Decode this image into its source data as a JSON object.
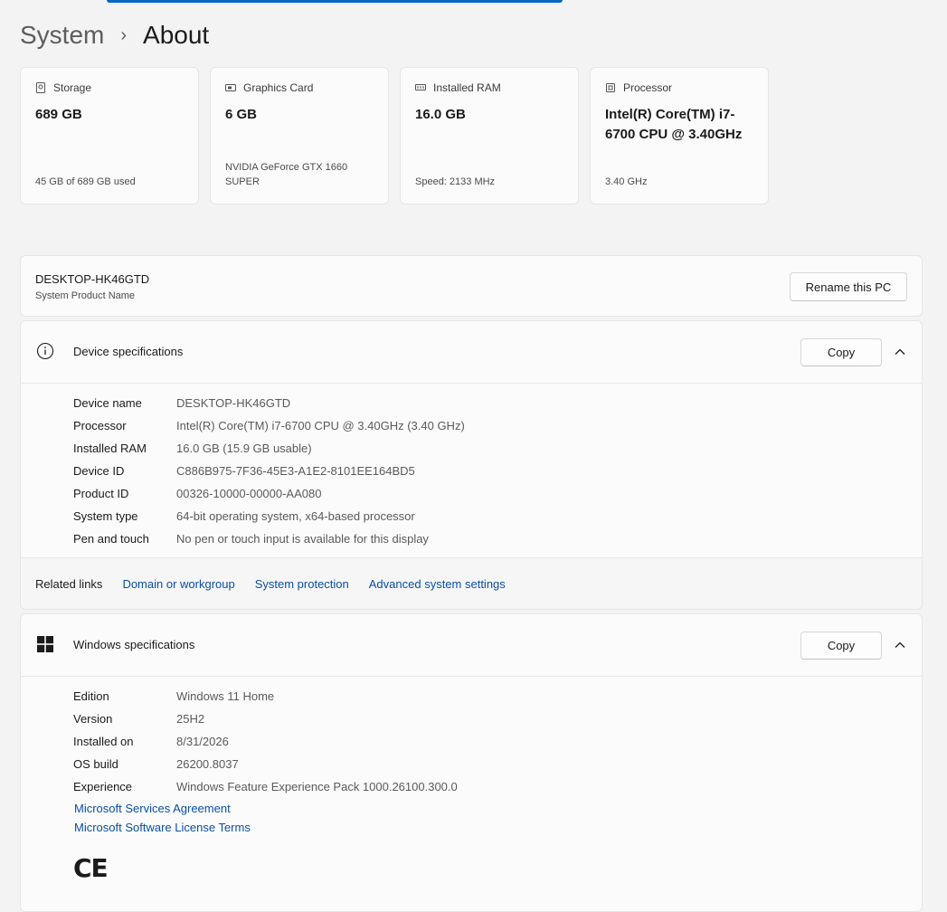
{
  "breadcrumb": {
    "parent": "System",
    "separator": "›",
    "current": "About"
  },
  "cards": [
    {
      "label": "Storage",
      "value": "689 GB",
      "sub": "45 GB of 689 GB used",
      "icon": "storage-icon"
    },
    {
      "label": "Graphics Card",
      "value": "6 GB",
      "sub": "NVIDIA GeForce GTX 1660 SUPER",
      "icon": "graphics-card-icon"
    },
    {
      "label": "Installed RAM",
      "value": "16.0 GB",
      "sub": "Speed: 2133 MHz",
      "icon": "ram-icon"
    },
    {
      "label": "Processor",
      "value": "Intel(R) Core(TM) i7-6700 CPU @ 3.40GHz",
      "sub": "3.40 GHz",
      "icon": "processor-icon"
    }
  ],
  "pc": {
    "name": "DESKTOP-HK46GTD",
    "sub": "System Product Name",
    "rename_label": "Rename this PC"
  },
  "device_specs": {
    "title": "Device specifications",
    "copy_label": "Copy",
    "rows": [
      {
        "label": "Device name",
        "value": "DESKTOP-HK46GTD"
      },
      {
        "label": "Processor",
        "value": "Intel(R) Core(TM) i7-6700 CPU @ 3.40GHz (3.40 GHz)"
      },
      {
        "label": "Installed RAM",
        "value": "16.0 GB (15.9 GB usable)"
      },
      {
        "label": "Device ID",
        "value": "C886B975-7F36-45E3-A1E2-8101EE164BD5"
      },
      {
        "label": "Product ID",
        "value": "00326-10000-00000-AA080"
      },
      {
        "label": "System type",
        "value": "64-bit operating system, x64-based processor"
      },
      {
        "label": "Pen and touch",
        "value": "No pen or touch input is available for this display"
      }
    ],
    "related_label": "Related links",
    "related_links": [
      "Domain or workgroup",
      "System protection",
      "Advanced system settings"
    ]
  },
  "windows_specs": {
    "title": "Windows specifications",
    "copy_label": "Copy",
    "rows": [
      {
        "label": "Edition",
        "value": "Windows 11 Home"
      },
      {
        "label": "Version",
        "value": "25H2"
      },
      {
        "label": "Installed on",
        "value": "8/31/2026"
      },
      {
        "label": "OS build",
        "value": "26200.8037"
      },
      {
        "label": "Experience",
        "value": "Windows Feature Experience Pack 1000.26100.300.0"
      }
    ],
    "links": [
      "Microsoft Services Agreement",
      "Microsoft Software License Terms"
    ],
    "ce_mark": "CE"
  },
  "colors": {
    "accent": "#0067c0",
    "link": "#0a4fa6",
    "background": "#f3f3f3",
    "card": "#fbfbfb"
  }
}
